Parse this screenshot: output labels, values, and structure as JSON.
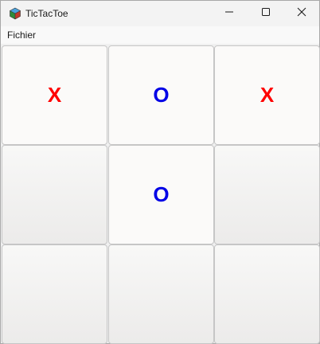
{
  "window": {
    "title": "TicTacToe",
    "icon": "cube-app-icon"
  },
  "menu": {
    "items": [
      {
        "label": "Fichier"
      }
    ]
  },
  "board": {
    "cells": [
      {
        "mark": "X",
        "color": "#ff0000"
      },
      {
        "mark": "O",
        "color": "#0000e6"
      },
      {
        "mark": "X",
        "color": "#ff0000"
      },
      {
        "mark": ""
      },
      {
        "mark": "O",
        "color": "#0000e6"
      },
      {
        "mark": ""
      },
      {
        "mark": ""
      },
      {
        "mark": ""
      },
      {
        "mark": ""
      }
    ]
  }
}
